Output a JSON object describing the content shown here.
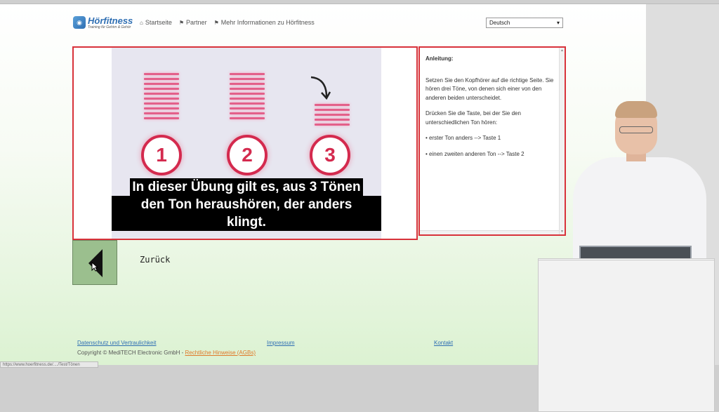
{
  "header": {
    "logo_name": "Hörfitness",
    "logo_tagline": "Training für Gehirn & Gehör",
    "nav": [
      {
        "label": "Startseite",
        "icon": "home-icon"
      },
      {
        "label": "Partner",
        "icon": "flag-icon"
      },
      {
        "label": "Mehr Informationen zu Hörfitness",
        "icon": "flag-icon"
      }
    ],
    "language": "Deutsch"
  },
  "video": {
    "numbers": [
      "1",
      "2",
      "3"
    ],
    "subtitle_lines": [
      "In dieser Übung gilt es, aus 3 Tönen",
      "den Ton heraushören, der anders",
      "klingt."
    ]
  },
  "instructions": {
    "title": "Anleitung:",
    "paragraph1": "Setzen Sie den Kopfhörer auf die richtige Seite. Sie hören drei Töne, von denen sich einer von den anderen beiden unterscheidet.",
    "paragraph2": "Drücken Sie die Taste, bei der Sie den unterschiedlichen Ton hören:",
    "bullet1": "• erster Ton anders --> Taste 1",
    "bullet2": "• einen zweiten anderen Ton --> Taste 2"
  },
  "back": {
    "label": "Zurück"
  },
  "footer": {
    "privacy": "Datenschutz und Vertraulichkeit",
    "imprint": "Impressum",
    "contact": "Kontakt",
    "copyright": "Copyright © MediTECH Electronic GmbH - ",
    "legal": "Rechtliche Hinweise (AGBs)"
  },
  "status_url": "https://www.hoerfitness.de/..../Test/Tönen",
  "colors": {
    "accent_red": "#d8323a",
    "brand_blue": "#2f6fb3",
    "back_green": "#9bbf8e"
  }
}
